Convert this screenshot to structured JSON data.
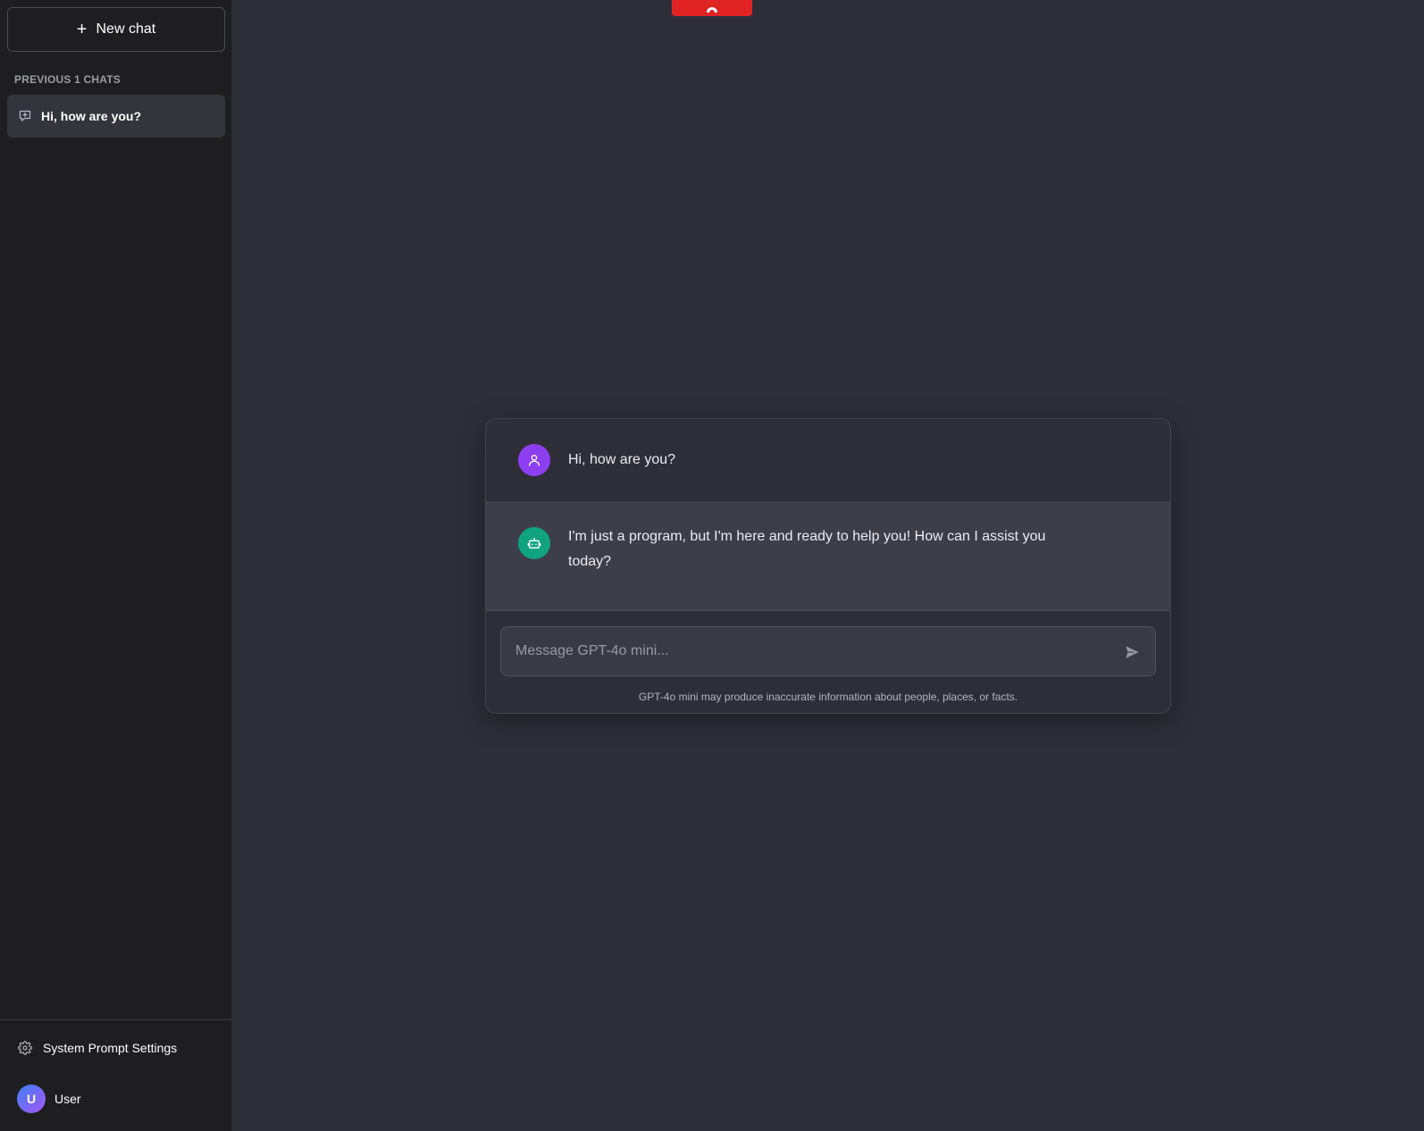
{
  "sidebar": {
    "new_chat_label": "New chat",
    "section_label": "PREVIOUS 1 CHATS",
    "chats": [
      {
        "title": "Hi, how are you?"
      }
    ],
    "settings_label": "System Prompt Settings",
    "user": {
      "initial": "U",
      "name": "User"
    }
  },
  "conversation": {
    "messages": [
      {
        "role": "user",
        "text": "Hi, how are you?"
      },
      {
        "role": "assistant",
        "text": "I'm just a program, but I'm here and ready to help you! How can I assist you today?"
      }
    ]
  },
  "composer": {
    "placeholder": "Message GPT-4o mini...",
    "value": "",
    "disclaimer": "GPT-4o mini may produce inaccurate information about people, places, or facts."
  },
  "colors": {
    "sidebar_bg": "#1e1e20",
    "main_bg": "#2e2e38",
    "user_avatar": "#8b3ff0",
    "assistant_avatar": "#10a37f",
    "top_tab": "#e02424"
  },
  "icons": {
    "new_chat": "plus-icon",
    "chat_item": "chat-bubble-icon",
    "settings": "gear-icon",
    "user_message": "person-icon",
    "assistant_message": "robot-icon",
    "send": "send-icon",
    "top_tab": "tab-handle-icon"
  }
}
